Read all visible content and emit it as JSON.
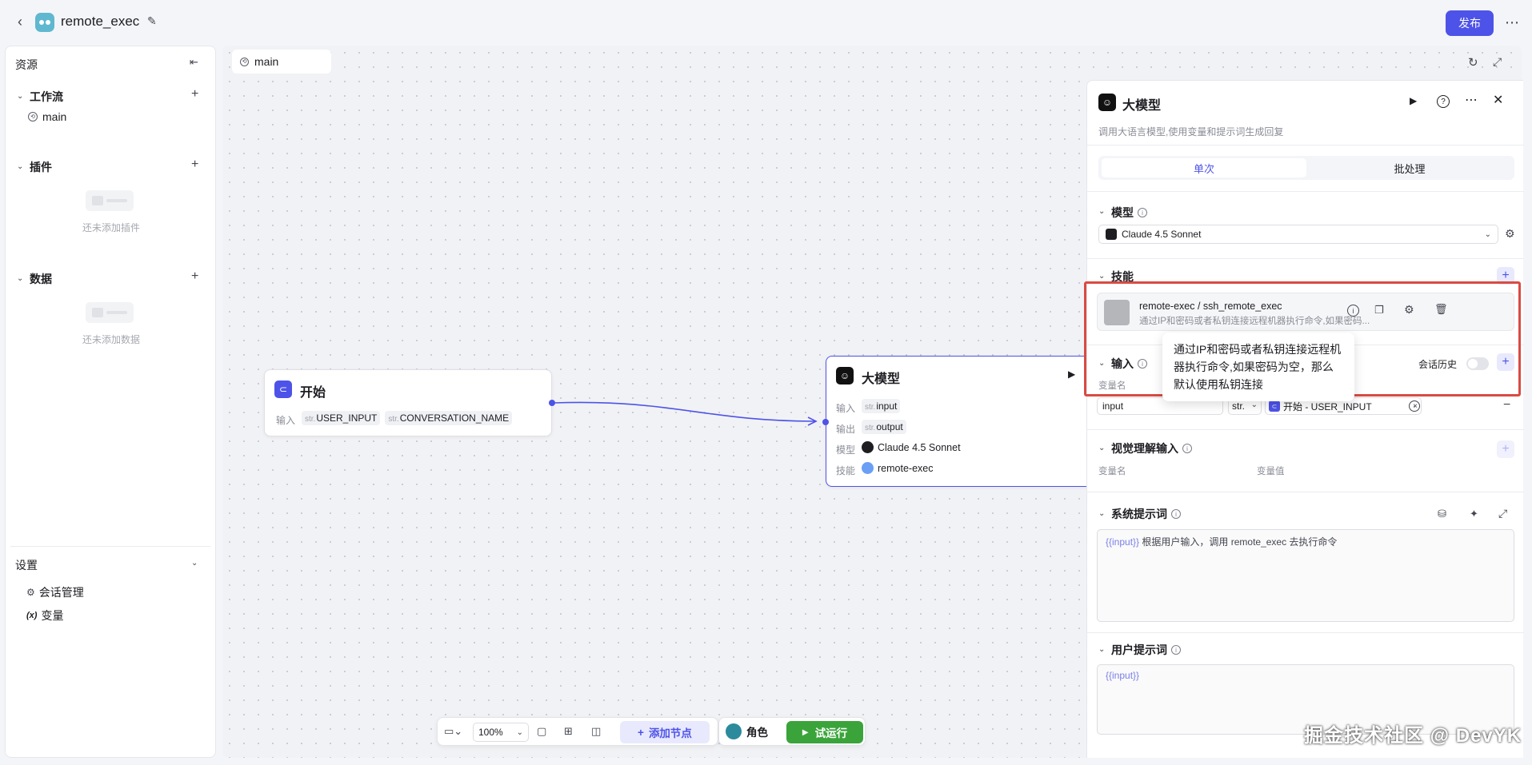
{
  "app": {
    "title": "remote_exec",
    "publish_label": "发布"
  },
  "sidebar": {
    "resources_title": "资源",
    "workflow": {
      "title": "工作流",
      "items": [
        {
          "label": "main"
        }
      ]
    },
    "plugins": {
      "title": "插件",
      "empty": "还未添加插件"
    },
    "data": {
      "title": "数据",
      "empty": "还未添加数据"
    },
    "settings": {
      "title": "设置",
      "items": [
        {
          "label": "会话管理"
        },
        {
          "label": "变量"
        }
      ]
    }
  },
  "canvas": {
    "tab_label": "main",
    "start_node": {
      "title": "开始",
      "input_label": "输入",
      "inputs": [
        {
          "type": "str.",
          "name": "USER_INPUT"
        },
        {
          "type": "str.",
          "name": "CONVERSATION_NAME"
        }
      ]
    },
    "llm_node": {
      "title": "大模型",
      "rows": [
        {
          "label": "输入",
          "type": "str.",
          "value": "input"
        },
        {
          "label": "输出",
          "type": "str.",
          "value": "output"
        },
        {
          "label": "模型",
          "value": "Claude 4.5 Sonnet"
        },
        {
          "label": "技能",
          "value": "remote-exec"
        }
      ]
    },
    "toolbar": {
      "zoom": "100%",
      "add_node": "添加节点",
      "role": "角色",
      "test_run": "试运行"
    }
  },
  "panel": {
    "title": "大模型",
    "subtitle": "调用大语言模型,使用变量和提示词生成回复",
    "tabs": [
      {
        "label": "单次",
        "active": true
      },
      {
        "label": "批处理",
        "active": false
      }
    ],
    "model": {
      "title": "模型",
      "selected": "Claude 4.5 Sonnet"
    },
    "skills": {
      "title": "技能",
      "item": {
        "name": "remote-exec / ssh_remote_exec",
        "desc": "通过IP和密码或者私钥连接远程机器执行命令,如果密码..."
      }
    },
    "tooltip": "通过IP和密码或者私钥连接远程机器执行命令,如果密码为空，那么默认使用私钥连接",
    "input": {
      "title": "输入",
      "history_label": "会话历史",
      "col_name": "变量名",
      "var_name": "input",
      "var_type": "str.",
      "var_ref": "开始 - USER_INPUT"
    },
    "vision": {
      "title": "视觉理解输入",
      "col_name": "变量名",
      "col_value": "变量值"
    },
    "system_prompt": {
      "title": "系统提示词",
      "var": "{{input}}",
      "text": " 根据用户输入，调用 remote_exec 去执行命令"
    },
    "user_prompt": {
      "title": "用户提示词",
      "var": "{{input}}"
    }
  },
  "watermark": "掘金技术社区 @ DevYK",
  "colors": {
    "accent": "#4d53e8",
    "run_green": "#3aa43b",
    "highlight_red": "#d94b43"
  }
}
